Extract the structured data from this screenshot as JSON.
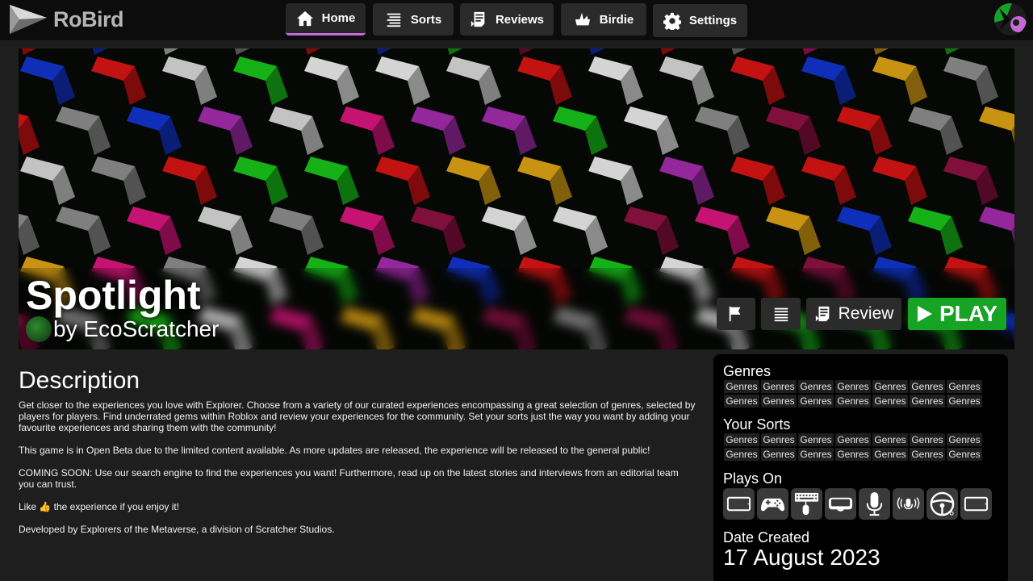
{
  "app": {
    "name": "RoBird"
  },
  "nav": {
    "home": "Home",
    "sorts": "Sorts",
    "reviews": "Reviews",
    "birdie": "Birdie",
    "settings": "Settings"
  },
  "game": {
    "title": "Spotlight",
    "creator": "by EcoScratcher",
    "review_label": "Review",
    "play_label": "PLAY"
  },
  "description": {
    "heading": "Description",
    "paragraphs": [
      "Get closer to the experiences you love with Explorer. Choose from a variety of our curated experiences encompassing a great selection of genres, selected by players for players. Find underrated gems within Roblox and review your experiences for the community. Set your sorts just the way you want by adding your favourite experiences and sharing them with the community!",
      "This game is in Open Beta due to the limited content available. As more updates are released, the experience will be released to the general public!",
      "COMING SOON: Use our search engine to find the experiences you want! Furthermore, read up on the latest stories and interviews from an editorial team you can trust.",
      "Like 👍 the experience if you enjoy it!",
      "Developed by Explorers of the Metaverse, a division of Scratcher Studios."
    ]
  },
  "side": {
    "genres_heading": "Genres",
    "genres": [
      "Genres",
      "Genres",
      "Genres",
      "Genres",
      "Genres",
      "Genres",
      "Genres",
      "Genres",
      "Genres",
      "Genres",
      "Genres",
      "Genres",
      "Genres",
      "Genres"
    ],
    "sorts_heading": "Your Sorts",
    "sorts": [
      "Genres",
      "Genres",
      "Genres",
      "Genres",
      "Genres",
      "Genres",
      "Genres",
      "Genres",
      "Genres",
      "Genres",
      "Genres",
      "Genres",
      "Genres",
      "Genres"
    ],
    "plays_on_heading": "Plays On",
    "platform_icons": [
      "tablet-landscape-icon",
      "gamepad-icon",
      "keyboard-mouse-icon",
      "vr-headset-icon",
      "microphone-icon",
      "spatial-voice-icon",
      "steering-wheel-icon",
      "tablet-landscape-icon"
    ],
    "date_heading": "Date Created",
    "date_value": "17 August 2023"
  },
  "colors": {
    "accent": "#c26ad6",
    "play": "#17a323",
    "topbar": "#0c0c0c",
    "background": "#1e1e1e"
  }
}
